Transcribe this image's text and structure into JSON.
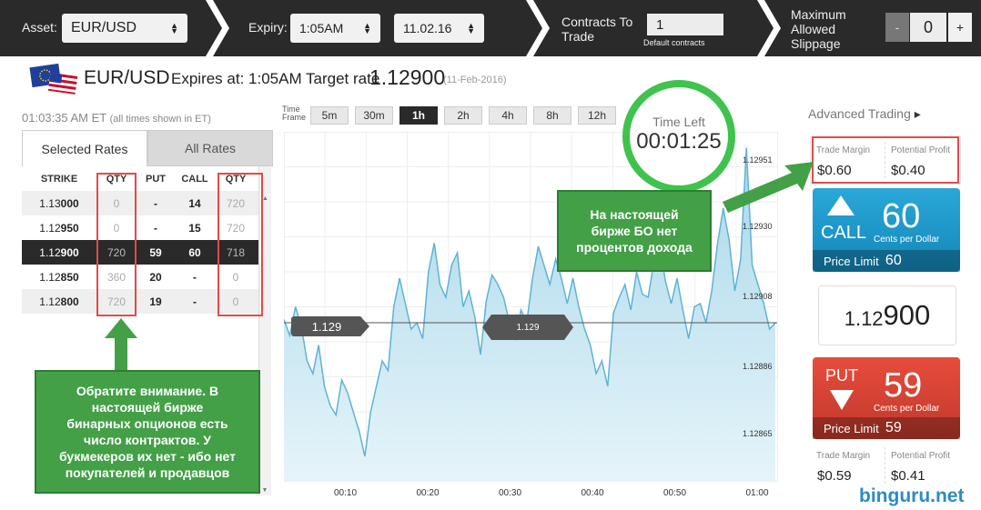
{
  "topbar": {
    "asset_label": "Asset:",
    "asset_value": "EUR/USD",
    "expiry_label": "Expiry:",
    "expiry_time": "1:05AM",
    "expiry_date": "11.02.16",
    "contracts_label_line1": "Contracts To",
    "contracts_label_line2": "Trade",
    "contracts_value": "1",
    "default_contracts": "Default contracts",
    "slippage_line1": "Maximum",
    "slippage_line2": "Allowed",
    "slippage_line3": "Slippage",
    "minus": "-",
    "slippage_value": "0",
    "plus": "+"
  },
  "header": {
    "asset": "EUR/USD",
    "expires_text": "Expires at: 1:05AM Target rate",
    "target_rate": "1.12900",
    "date_note": "(11-Feb-2016)",
    "clock": "01:03:35 AM ET",
    "clock_note": "(all times shown in ET)"
  },
  "timeframe": {
    "label_line1": "Time",
    "label_line2": "Frame",
    "options": [
      "5m",
      "30m",
      "1h",
      "2h",
      "4h",
      "8h",
      "12h"
    ],
    "selected": "1h"
  },
  "timer": {
    "label": "Time Left",
    "value": "00:01:25"
  },
  "advanced": {
    "label": "Advanced Trading",
    "arrow": "▸"
  },
  "rates": {
    "tab_selected": "Selected Rates",
    "tab_all": "All Rates",
    "columns": [
      "STRIKE",
      "QTY",
      "PUT",
      "CALL",
      "QTY"
    ],
    "rows": [
      {
        "strike_a": "1.13",
        "strike_b": "000",
        "qty1": "0",
        "put": "-",
        "call": "14",
        "qty2": "720"
      },
      {
        "strike_a": "1.12",
        "strike_b": "950",
        "qty1": "0",
        "put": "-",
        "call": "15",
        "qty2": "720"
      },
      {
        "strike_a": "1.12",
        "strike_b": "900",
        "qty1": "720",
        "put": "59",
        "call": "60",
        "qty2": "718"
      },
      {
        "strike_a": "1.12",
        "strike_b": "850",
        "qty1": "360",
        "put": "20",
        "call": "-",
        "qty2": "0"
      },
      {
        "strike_a": "1.12",
        "strike_b": "800",
        "qty1": "720",
        "put": "19",
        "call": "-",
        "qty2": "0"
      }
    ]
  },
  "chart_data": {
    "type": "area",
    "x_ticks": [
      "00:10",
      "00:20",
      "00:30",
      "00:40",
      "00:50",
      "01:00"
    ],
    "y_ticks": [
      "1.12951",
      "1.12930",
      "1.12908",
      "1.12886",
      "1.12865"
    ],
    "strike_tag": "1.129",
    "current_tag": "1.129",
    "ylim": [
      1.1285,
      1.1296
    ],
    "values": [
      1.12901,
      1.12896,
      1.12905,
      1.12899,
      1.12888,
      1.12884,
      1.12893,
      1.1288,
      1.12874,
      1.12871,
      1.12882,
      1.12878,
      1.12872,
      1.12866,
      1.12858,
      1.12872,
      1.1288,
      1.12888,
      1.12885,
      1.12905,
      1.12914,
      1.12906,
      1.12898,
      1.129,
      1.12895,
      1.12916,
      1.12925,
      1.12912,
      1.12908,
      1.12918,
      1.12922,
      1.12905,
      1.1291,
      1.12902,
      1.1289,
      1.12907,
      1.12915,
      1.12912,
      1.12908,
      1.129,
      1.12895,
      1.12904,
      1.129,
      1.12914,
      1.12924,
      1.12918,
      1.12912,
      1.1292,
      1.12914,
      1.12906,
      1.12914,
      1.12905,
      1.12898,
      1.12893,
      1.12884,
      1.12888,
      1.1288,
      1.12903,
      1.12908,
      1.12912,
      1.12904,
      1.12916,
      1.12909,
      1.12908,
      1.12919,
      1.12924,
      1.12913,
      1.12906,
      1.12914,
      1.12904,
      1.12895,
      1.12905,
      1.12906,
      1.129,
      1.1291,
      1.12925,
      1.12936,
      1.12926,
      1.1291,
      1.1292,
      1.12955,
      1.12918,
      1.12912,
      1.12906,
      1.12898,
      1.129
    ]
  },
  "panel": {
    "trade_margin_label": "Trade Margin",
    "potential_profit_label": "Potential Profit",
    "call_margin": "$0.60",
    "call_profit": "$0.40",
    "call_label": "CALL",
    "call_price": "60",
    "cents_per_dollar": "Cents per Dollar",
    "price_limit_label": "Price Limit",
    "call_limit": "60",
    "current_price_a": "1.12",
    "current_price_b": "900",
    "put_label": "PUT",
    "put_price": "59",
    "put_limit": "59",
    "put_margin": "$0.59",
    "put_profit": "$0.41"
  },
  "annotations": {
    "left_note": [
      "Обратите внимание. В",
      "настоящей бирже",
      "бинарных опционов есть",
      "число контрактов. У",
      "букмекеров их нет - ибо нет",
      "покупателей и продавцов"
    ],
    "right_note": [
      "На настоящей",
      "бирже БО нет",
      "процентов дохода"
    ]
  },
  "watermark": "binguru.net",
  "colors": {
    "call": "#1f9bcf",
    "put": "#d64133",
    "timer": "#3fc34c",
    "note": "#43a047",
    "highlight": "#e24a4a"
  }
}
